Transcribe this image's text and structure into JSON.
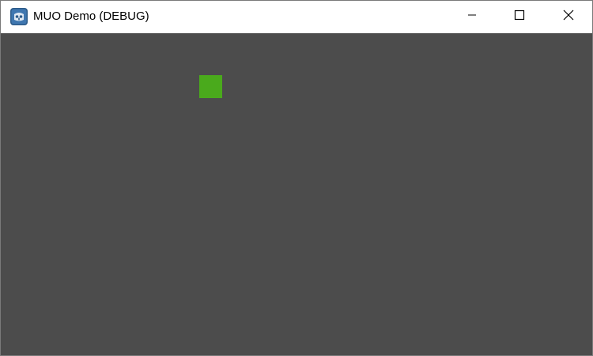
{
  "window": {
    "title": "MUO Demo (DEBUG)",
    "icon": "godot-engine-icon",
    "controls": {
      "minimize_icon": "minimize-icon",
      "maximize_icon": "maximize-icon",
      "close_icon": "close-icon"
    }
  },
  "game": {
    "background_color": "#4c4c4c",
    "player": {
      "shape": "square",
      "color": "#4aaa1c"
    }
  }
}
